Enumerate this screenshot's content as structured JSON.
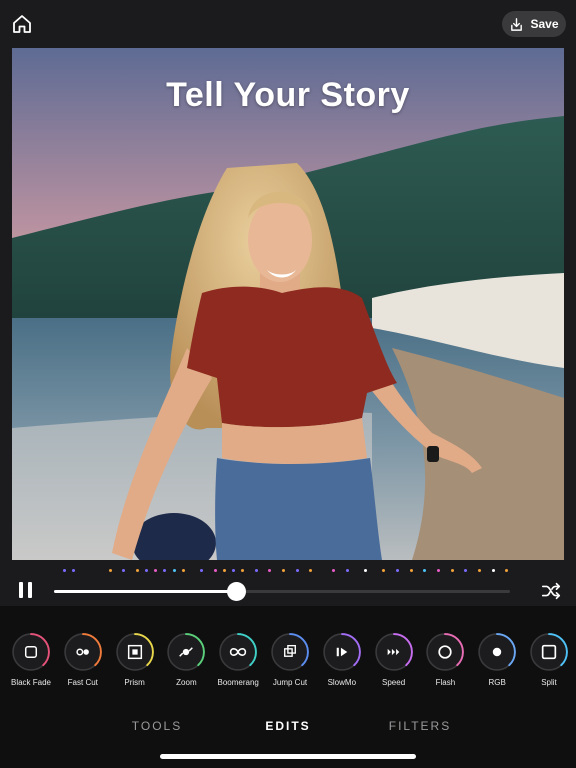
{
  "header": {
    "home_icon": "home-icon",
    "save_label": "Save",
    "save_icon": "download-icon"
  },
  "photo": {
    "overlay_title": "Tell Your Story"
  },
  "playback": {
    "state": "playing",
    "progress": 0.4,
    "pause_icon": "pause-icon",
    "shuffle_icon": "shuffle-icon",
    "markers": [
      {
        "pos": 0.02,
        "color": "#7b6cff"
      },
      {
        "pos": 0.04,
        "color": "#7b6cff"
      },
      {
        "pos": 0.12,
        "color": "#f3a23b"
      },
      {
        "pos": 0.15,
        "color": "#7b6cff"
      },
      {
        "pos": 0.18,
        "color": "#f3a23b"
      },
      {
        "pos": 0.2,
        "color": "#7b6cff"
      },
      {
        "pos": 0.22,
        "color": "#e85cc7"
      },
      {
        "pos": 0.24,
        "color": "#7b6cff"
      },
      {
        "pos": 0.26,
        "color": "#4fc3f7"
      },
      {
        "pos": 0.28,
        "color": "#f3a23b"
      },
      {
        "pos": 0.32,
        "color": "#7b6cff"
      },
      {
        "pos": 0.35,
        "color": "#e85cc7"
      },
      {
        "pos": 0.37,
        "color": "#f3a23b"
      },
      {
        "pos": 0.39,
        "color": "#7b6cff"
      },
      {
        "pos": 0.41,
        "color": "#f3a23b"
      },
      {
        "pos": 0.44,
        "color": "#7b6cff"
      },
      {
        "pos": 0.47,
        "color": "#e85cc7"
      },
      {
        "pos": 0.5,
        "color": "#f3a23b"
      },
      {
        "pos": 0.53,
        "color": "#7b6cff"
      },
      {
        "pos": 0.56,
        "color": "#f3a23b"
      },
      {
        "pos": 0.61,
        "color": "#e85cc7"
      },
      {
        "pos": 0.64,
        "color": "#7b6cff"
      },
      {
        "pos": 0.68,
        "color": "#ffffff"
      },
      {
        "pos": 0.72,
        "color": "#f3a23b"
      },
      {
        "pos": 0.75,
        "color": "#7b6cff"
      },
      {
        "pos": 0.78,
        "color": "#f3a23b"
      },
      {
        "pos": 0.81,
        "color": "#4fc3f7"
      },
      {
        "pos": 0.84,
        "color": "#e85cc7"
      },
      {
        "pos": 0.87,
        "color": "#f3a23b"
      },
      {
        "pos": 0.9,
        "color": "#7b6cff"
      },
      {
        "pos": 0.93,
        "color": "#f3a23b"
      },
      {
        "pos": 0.96,
        "color": "#ffffff"
      },
      {
        "pos": 0.99,
        "color": "#f3a23b"
      }
    ]
  },
  "tools": [
    {
      "label": "Black Fade",
      "icon": "black-fade-icon",
      "color": "#e8527a"
    },
    {
      "label": "Fast Cut",
      "icon": "fast-cut-icon",
      "color": "#f07b3a"
    },
    {
      "label": "Prism",
      "icon": "prism-icon",
      "color": "#e9d84a"
    },
    {
      "label": "Zoom",
      "icon": "zoom-icon",
      "color": "#5ad17a"
    },
    {
      "label": "Boomerang",
      "icon": "boomerang-icon",
      "color": "#3fd1c8"
    },
    {
      "label": "Jump Cut",
      "icon": "jump-cut-icon",
      "color": "#5b8ef0"
    },
    {
      "label": "SlowMo",
      "icon": "slowmo-icon",
      "color": "#a36df5"
    },
    {
      "label": "Speed",
      "icon": "speed-icon",
      "color": "#c86df0"
    },
    {
      "label": "Flash",
      "icon": "flash-icon",
      "color": "#e86db5"
    },
    {
      "label": "RGB",
      "icon": "rgb-icon",
      "color": "#6aa8f5"
    },
    {
      "label": "Split",
      "icon": "split-icon",
      "color": "#4fc3f7"
    }
  ],
  "tabs": [
    {
      "label": "TOOLS",
      "active": false
    },
    {
      "label": "EDITS",
      "active": true
    },
    {
      "label": "FILTERS",
      "active": false
    }
  ]
}
